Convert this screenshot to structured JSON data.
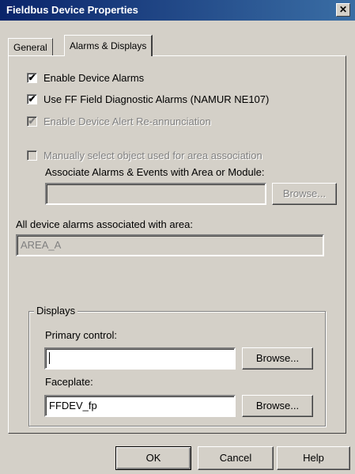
{
  "window": {
    "title": "Fieldbus Device Properties"
  },
  "tabs": [
    {
      "label": "General"
    },
    {
      "label": "Alarms & Displays"
    }
  ],
  "options": {
    "enable_device_alarms": {
      "label": "Enable Device Alarms",
      "checked": true
    },
    "use_ff_diag": {
      "label": "Use FF Field Diagnostic Alarms (NAMUR NE107)",
      "checked": true
    },
    "reannunciation": {
      "label": "Enable Device Alert Re-annunciation",
      "checked": true,
      "disabled": true
    },
    "manual_select": {
      "label": "Manually select object used for area association",
      "checked": false,
      "disabled": true
    }
  },
  "associate": {
    "label": "Associate Alarms & Events with Area or Module:",
    "value": "",
    "browse_label": "Browse..."
  },
  "area": {
    "label": "All device alarms associated with area:",
    "value": "AREA_A"
  },
  "displays": {
    "group_label": "Displays",
    "primary_control_label": "Primary control:",
    "primary_control_value": "",
    "primary_browse_label": "Browse...",
    "faceplate_label": "Faceplate:",
    "faceplate_value": "FFDEV_fp",
    "faceplate_browse_label": "Browse..."
  },
  "footer": {
    "ok": "OK",
    "cancel": "Cancel",
    "help": "Help"
  }
}
